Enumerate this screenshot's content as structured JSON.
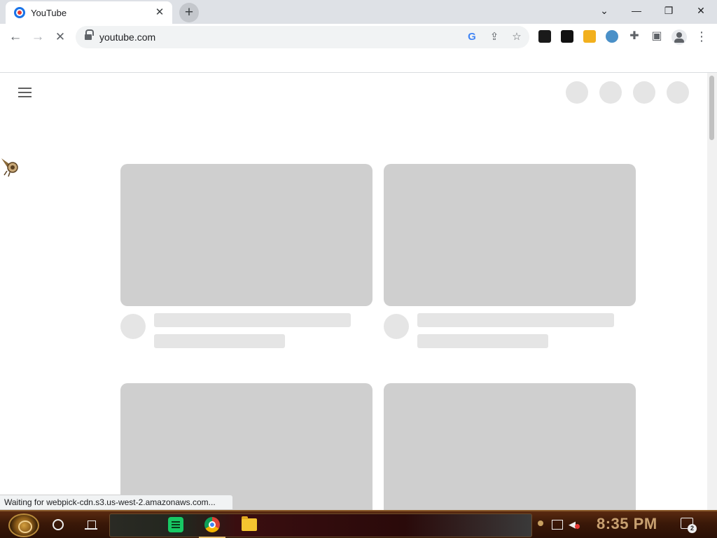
{
  "browser": {
    "tab": {
      "title": "YouTube",
      "close_glyph": "✕"
    },
    "new_tab_glyph": "+",
    "window_controls": {
      "tab_search": "⌄",
      "minimize": "—",
      "restore": "❐",
      "close": "✕"
    },
    "toolbar": {
      "back_glyph": "←",
      "forward_glyph": "→",
      "stop_glyph": "✕",
      "url": "youtube.com",
      "menu_glyph": "⋮"
    },
    "extensions": [
      {
        "name": "extension-link-icon",
        "color": "#1a1a1a"
      },
      {
        "name": "extension-dark-icon",
        "color": "#111111"
      },
      {
        "name": "extension-yellow-icon",
        "color": "#f2b01e"
      },
      {
        "name": "extension-avatar-icon",
        "color": "#4a90c8"
      }
    ],
    "status_text": "Waiting for webpick-cdn.s3.us-west-2.amazonaws.com..."
  },
  "taskbar": {
    "clock": "8:35 PM",
    "notification_count": "2",
    "apps": [
      "notes-app",
      "chrome",
      "file-explorer"
    ]
  },
  "colors": {
    "skeleton_thumb": "#cfcfcf",
    "skeleton_light": "#e5e5e5",
    "accent_clock": "#c8a070"
  }
}
